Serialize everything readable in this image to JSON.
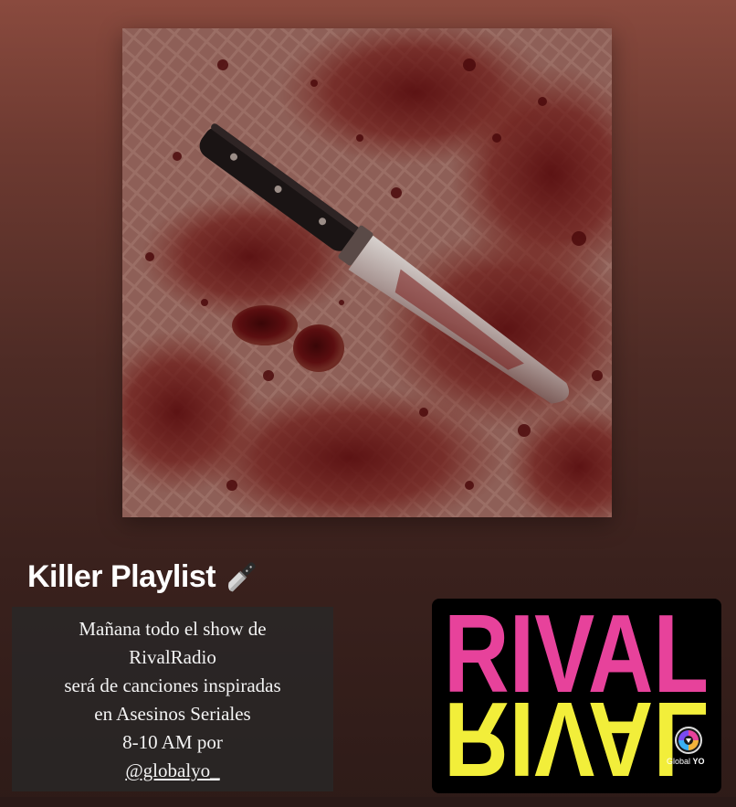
{
  "playlist": {
    "title": "Killer Playlist",
    "title_icon": "kitchen-knife-icon"
  },
  "cover": {
    "icon": "bloody-knife-on-tiles-artwork"
  },
  "caption": {
    "lines": [
      "Mañana todo el show de",
      "RivalRadio",
      "será de canciones inspiradas",
      "en Asesinos Seriales",
      "8-10 AM por"
    ],
    "handle": "@globalyo_"
  },
  "logo": {
    "word": "RIVAL",
    "top_color": "#e7429b",
    "bottom_color": "#f2ee3a",
    "badge_brand": "Global",
    "badge_brand_bold": "YO"
  },
  "colors": {
    "background_top": "#8a4a3e",
    "background_bottom": "#2e1b18",
    "caption_bg": "#282828"
  }
}
